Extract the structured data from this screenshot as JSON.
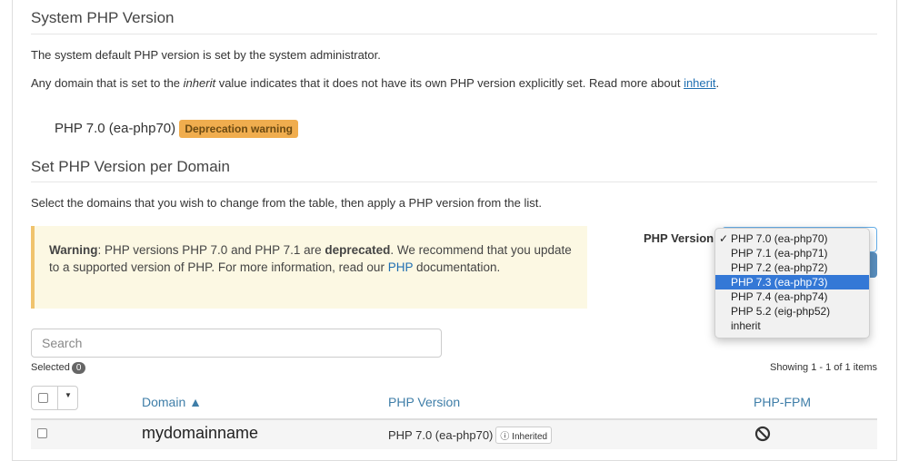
{
  "system": {
    "title": "System PHP Version",
    "desc1": "The system default PHP version is set by the system administrator.",
    "desc2_pre": "Any domain that is set to the ",
    "desc2_em": "inherit",
    "desc2_mid": " value indicates that it does not have its own PHP version explicitly set. Read more about ",
    "desc2_link": "inherit",
    "desc2_end": ".",
    "current": "PHP 7.0 (ea-php70)",
    "badge": "Deprecation warning"
  },
  "per_domain": {
    "title": "Set PHP Version per Domain",
    "desc": "Select the domains that you wish to change from the table, then apply a PHP version from the list.",
    "warning": {
      "label": "Warning",
      "t1": ": PHP versions PHP 7.0 and PHP 7.1 are ",
      "bold": "deprecated",
      "t2": ". We recommend that you update to a supported version of PHP. For more information, read our ",
      "link": "PHP",
      "t3": " documentation."
    },
    "php_version_label": "PHP Version",
    "dropdown": {
      "selected": "PHP 7.0 (ea-php70)",
      "highlighted": "PHP 7.3 (ea-php73)",
      "options": [
        "PHP 7.0 (ea-php70)",
        "PHP 7.1 (ea-php71)",
        "PHP 7.2 (ea-php72)",
        "PHP 7.3 (ea-php73)",
        "PHP 7.4 (ea-php74)",
        "PHP 5.2 (eig-php52)",
        "inherit"
      ]
    },
    "search_placeholder": "Search",
    "selected_label": "Selected",
    "selected_count": "0",
    "showing": "Showing 1 - 1 of 1 items",
    "columns": {
      "domain": "Domain ▲",
      "php_version": "PHP Version",
      "fpm": "PHP-FPM"
    },
    "rows": [
      {
        "domain": "mydomainname",
        "php_version": "PHP 7.0 (ea-php70)",
        "tag": "Inherited",
        "fpm": "disabled-icon"
      }
    ]
  },
  "colors": {
    "link": "#1f6fb2",
    "badge": "#f0ad4e",
    "highlight": "#3478d6",
    "warning_bg": "#fcf8e3"
  }
}
